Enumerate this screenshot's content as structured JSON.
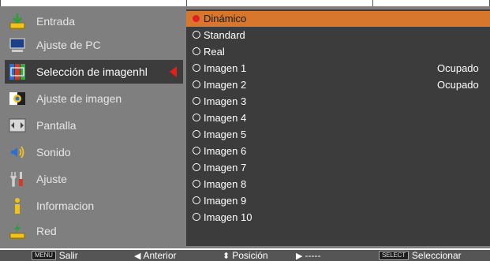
{
  "sidebar": {
    "items": [
      {
        "label": "Entrada",
        "icon": "input-icon",
        "selected": false
      },
      {
        "label": "Ajuste de PC",
        "icon": "pc-monitor-icon",
        "selected": false
      },
      {
        "label": "Selección de imagenhl",
        "icon": "image-select-icon",
        "selected": true
      },
      {
        "label": "Ajuste de imagen",
        "icon": "image-adjust-icon",
        "selected": false
      },
      {
        "label": "Pantalla",
        "icon": "screen-icon",
        "selected": false
      },
      {
        "label": "Sonido",
        "icon": "speaker-icon",
        "selected": false
      },
      {
        "label": "Ajuste",
        "icon": "tools-icon",
        "selected": false
      },
      {
        "label": "Informacion",
        "icon": "info-icon",
        "selected": false
      },
      {
        "label": "Red",
        "icon": "network-icon",
        "selected": false
      }
    ]
  },
  "options": [
    {
      "label": "Dinámico",
      "status": "",
      "selected": true
    },
    {
      "label": "Standard",
      "status": "",
      "selected": false
    },
    {
      "label": "Real",
      "status": "",
      "selected": false
    },
    {
      "label": "Imagen 1",
      "status": "Ocupado",
      "selected": false
    },
    {
      "label": "Imagen 2",
      "status": "Ocupado",
      "selected": false
    },
    {
      "label": "Imagen 3",
      "status": "",
      "selected": false
    },
    {
      "label": "Imagen 4",
      "status": "",
      "selected": false
    },
    {
      "label": "Imagen 5",
      "status": "",
      "selected": false
    },
    {
      "label": "Imagen 6",
      "status": "",
      "selected": false
    },
    {
      "label": "Imagen 7",
      "status": "",
      "selected": false
    },
    {
      "label": "Imagen 8",
      "status": "",
      "selected": false
    },
    {
      "label": "Imagen 9",
      "status": "",
      "selected": false
    },
    {
      "label": "Imagen 10",
      "status": "",
      "selected": false
    }
  ],
  "footer": {
    "menu_key": "MENU",
    "exit_label": "Salir",
    "prev_glyph": "◀",
    "prev_label": "Anterior",
    "pos_glyph": "⬍",
    "pos_label": "Posición",
    "next_glyph": "▶",
    "next_label": "-----",
    "select_key": "SELECT",
    "select_label": "Seleccionar"
  },
  "colors": {
    "panel": "#7f7f7f",
    "selected_bg": "#3c3c3c",
    "highlight": "#d6772d",
    "pointer": "#e0201b"
  }
}
